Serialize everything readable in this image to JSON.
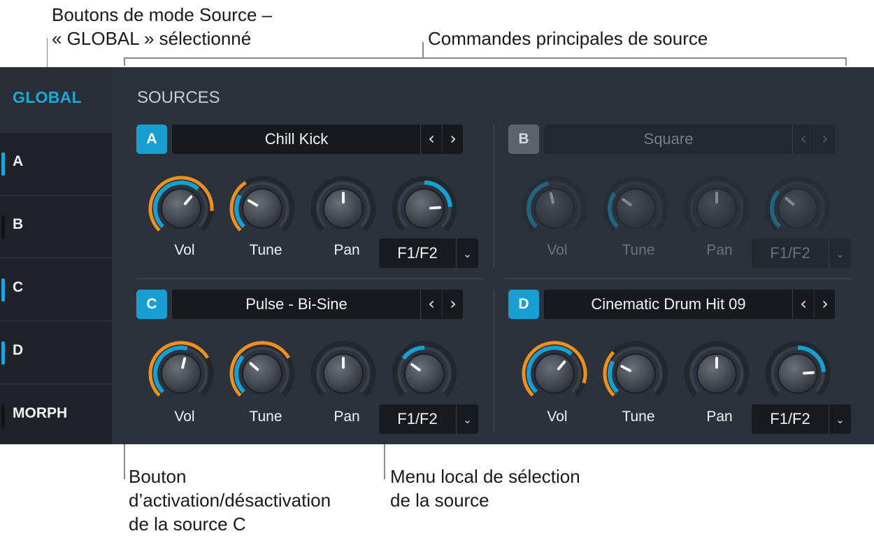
{
  "callouts": {
    "mode_buttons_line1": "Boutons de mode Source –",
    "mode_buttons_line2": "« GLOBAL » sélectionné",
    "main_controls": "Commandes principales de source",
    "toggle_line1": "Bouton",
    "toggle_line2": "d’activation/désactivation",
    "toggle_line3": "de la source C",
    "menu_line1": "Menu local de sélection",
    "menu_line2": "de la source"
  },
  "sidebar": {
    "global_label": "GLOBAL",
    "items": [
      {
        "label": "A",
        "active": true
      },
      {
        "label": "B",
        "active": false
      },
      {
        "label": "C",
        "active": true
      },
      {
        "label": "D",
        "active": true
      },
      {
        "label": "MORPH",
        "active": false
      }
    ]
  },
  "sources_title": "SOURCES",
  "sources": [
    {
      "id": "A",
      "name": "Chill Kick",
      "enabled": true,
      "knobs": [
        {
          "label": "Vol",
          "value": 0.65,
          "mod": 0.85
        },
        {
          "label": "Tune",
          "value": 0.28,
          "mod": 0.38
        },
        {
          "label": "Pan",
          "value": 0.5,
          "mod": 0
        },
        {
          "label": "F1/F2",
          "value": 0.82,
          "mod": 0
        }
      ],
      "morph_value": "F1/F2"
    },
    {
      "id": "B",
      "name": "Square",
      "enabled": false,
      "knobs": [
        {
          "label": "Vol",
          "value": 0.45,
          "mod": 0
        },
        {
          "label": "Tune",
          "value": 0.3,
          "mod": 0
        },
        {
          "label": "Pan",
          "value": 0.5,
          "mod": 0
        },
        {
          "label": "F1/F2",
          "value": 0.32,
          "mod": 0
        }
      ],
      "morph_value": "F1/F2"
    },
    {
      "id": "C",
      "name": "Pulse - Bi-Sine",
      "enabled": true,
      "knobs": [
        {
          "label": "Vol",
          "value": 0.55,
          "mod": 0.72
        },
        {
          "label": "Tune",
          "value": 0.32,
          "mod": 0.72
        },
        {
          "label": "Pan",
          "value": 0.5,
          "mod": 0
        },
        {
          "label": "F1/F2",
          "value": 0.3,
          "mod": 0
        }
      ],
      "morph_value": "F1/F2"
    },
    {
      "id": "D",
      "name": "Cinematic Drum Hit 09",
      "enabled": true,
      "knobs": [
        {
          "label": "Vol",
          "value": 0.65,
          "mod": 0.9
        },
        {
          "label": "Tune",
          "value": 0.27,
          "mod": 0.33
        },
        {
          "label": "Pan",
          "value": 0.5,
          "mod": 0
        },
        {
          "label": "F1/F2",
          "value": 0.82,
          "mod": 0
        }
      ],
      "morph_value": "F1/F2"
    }
  ],
  "colors": {
    "accent": "#169fd0",
    "modulation": "#f0901c",
    "panel": "#2c323b"
  },
  "icons": {
    "prev": "chevron-left-icon",
    "next": "chevron-right-icon",
    "dropdown": "chevron-down-icon"
  }
}
